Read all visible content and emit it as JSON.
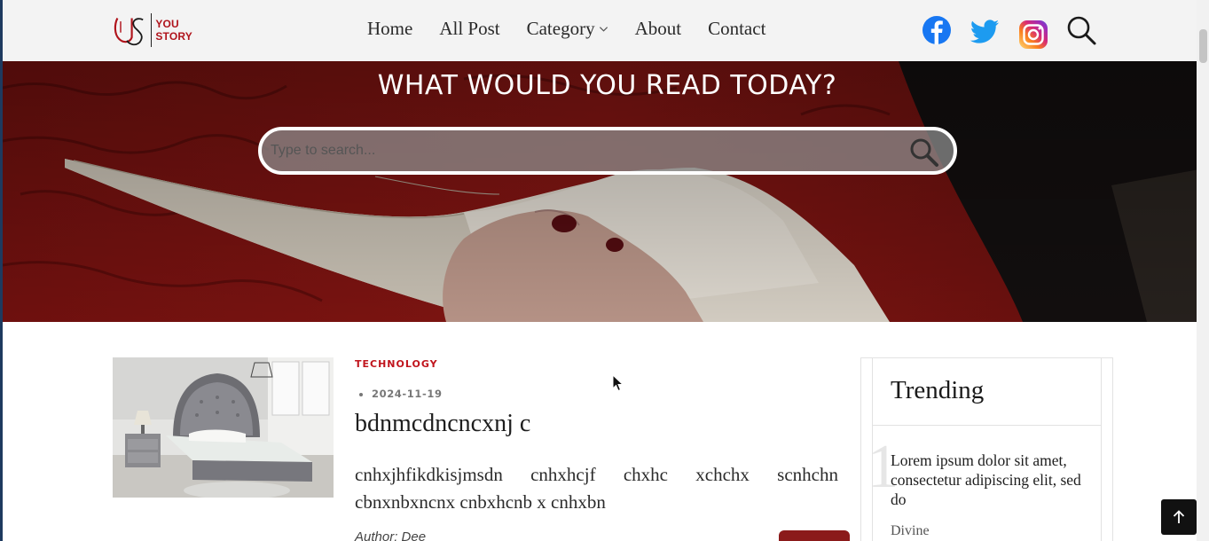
{
  "header": {
    "logo_line1": "YOU",
    "logo_line2": "STORY",
    "nav": [
      {
        "label": "Home"
      },
      {
        "label": "All Post"
      },
      {
        "label": "Category"
      },
      {
        "label": "About"
      },
      {
        "label": "Contact"
      }
    ],
    "icons": [
      "facebook-icon",
      "twitter-icon",
      "instagram-icon",
      "search-icon"
    ]
  },
  "hero": {
    "title": "WHAT WOULD YOU READ TODAY?",
    "search_placeholder": "Type to search..."
  },
  "post": {
    "category": "TECHNOLOGY",
    "date": "2024-11-19",
    "title": "bdnmcdncncxnj c",
    "excerpt": "cnhxjhfikdkisjmsdn cnhxhcjf chxhc xchchx scnhchn cbnxnbxncnx cnbxhcnb x cnhxbn",
    "author": "Author: Dee"
  },
  "trending": {
    "title": "Trending",
    "items": [
      {
        "rank": "1",
        "text": "Lorem ipsum dolor sit amet, consectetur adipiscing elit, sed do",
        "author": "Divine"
      }
    ]
  },
  "colors": {
    "accent": "#c0141c",
    "header_bg": "#f3f3f3",
    "button_dark": "#111111"
  }
}
